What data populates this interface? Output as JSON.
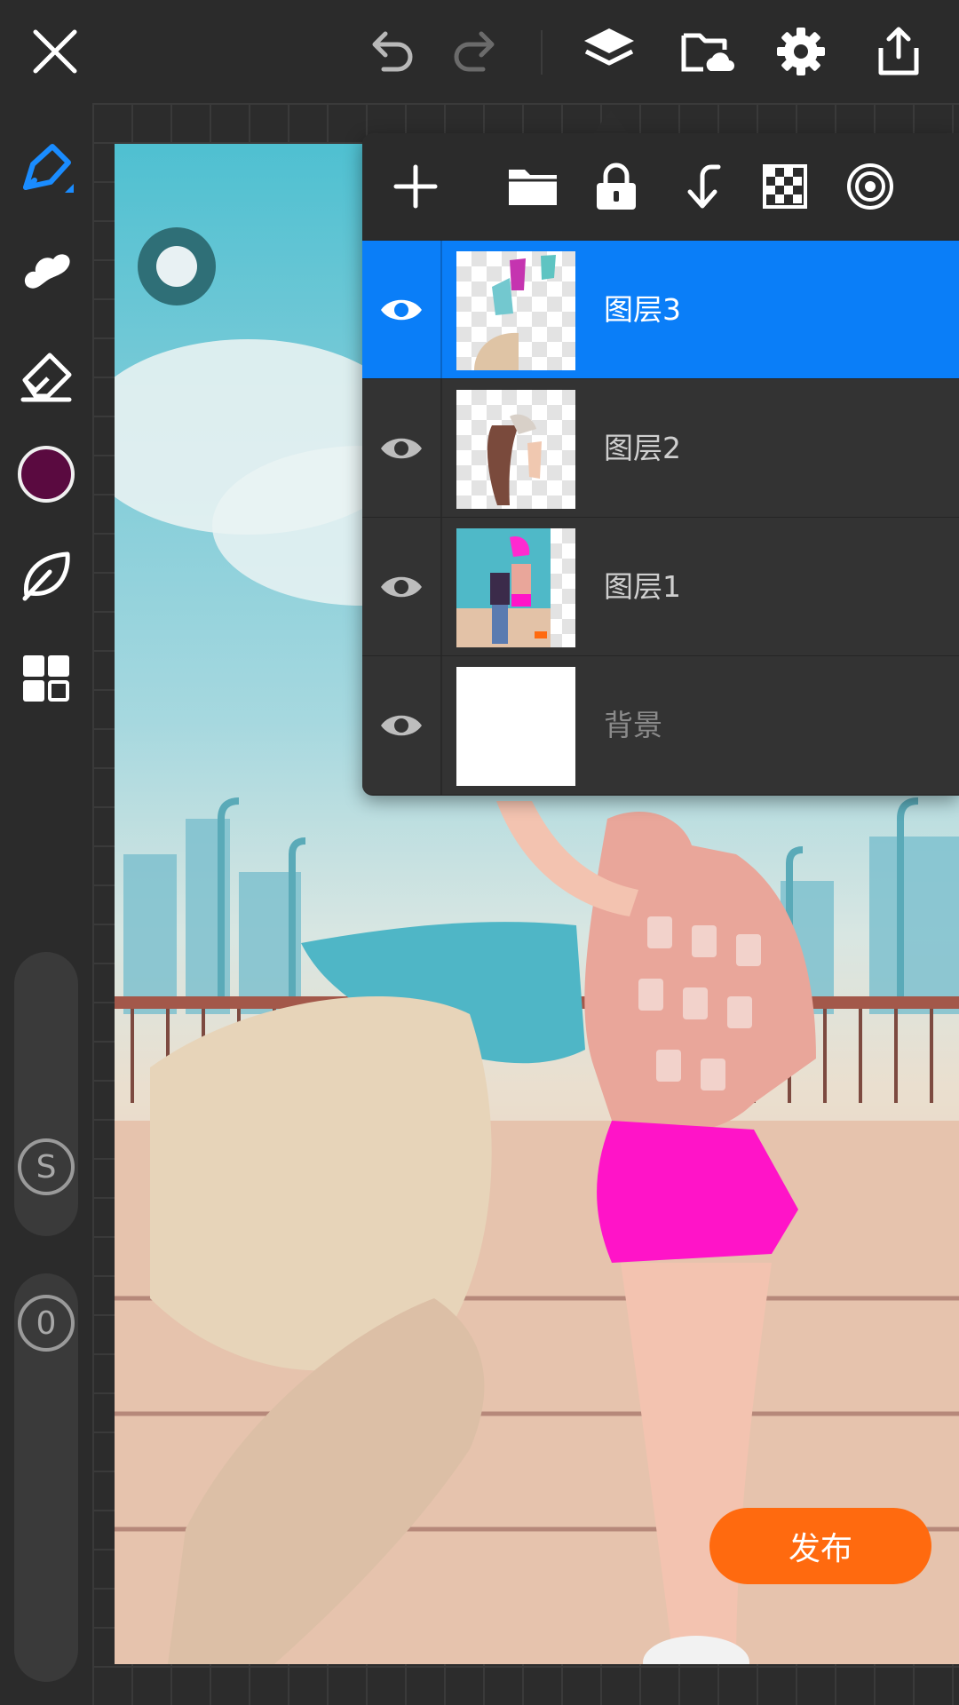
{
  "topbar": {
    "icons": [
      "close-icon",
      "undo-icon",
      "redo-icon",
      "layers-icon",
      "cloud-folder-icon",
      "gear-icon",
      "share-icon"
    ]
  },
  "tools": {
    "icons": [
      "pen-icon",
      "smudge-icon",
      "eraser-icon",
      "color-swatch",
      "leaf-icon",
      "grid-icon"
    ],
    "active_color": "#5a0a40",
    "accent": "#1a8cff",
    "size_slider_label": "S",
    "opacity_slider_label": "0"
  },
  "layers_panel": {
    "toolbar_icons": [
      "add-layer-icon",
      "folder-icon",
      "lock-icon",
      "merge-down-icon",
      "transparency-icon",
      "target-icon"
    ],
    "layers": [
      {
        "name": "图层3",
        "active": true,
        "visible": true
      },
      {
        "name": "图层2",
        "active": false,
        "visible": true
      },
      {
        "name": "图层1",
        "active": false,
        "visible": true
      },
      {
        "name": "背景",
        "active": false,
        "visible": true
      }
    ]
  },
  "publish_button": {
    "label": "发布",
    "color": "#ff6a0f"
  }
}
